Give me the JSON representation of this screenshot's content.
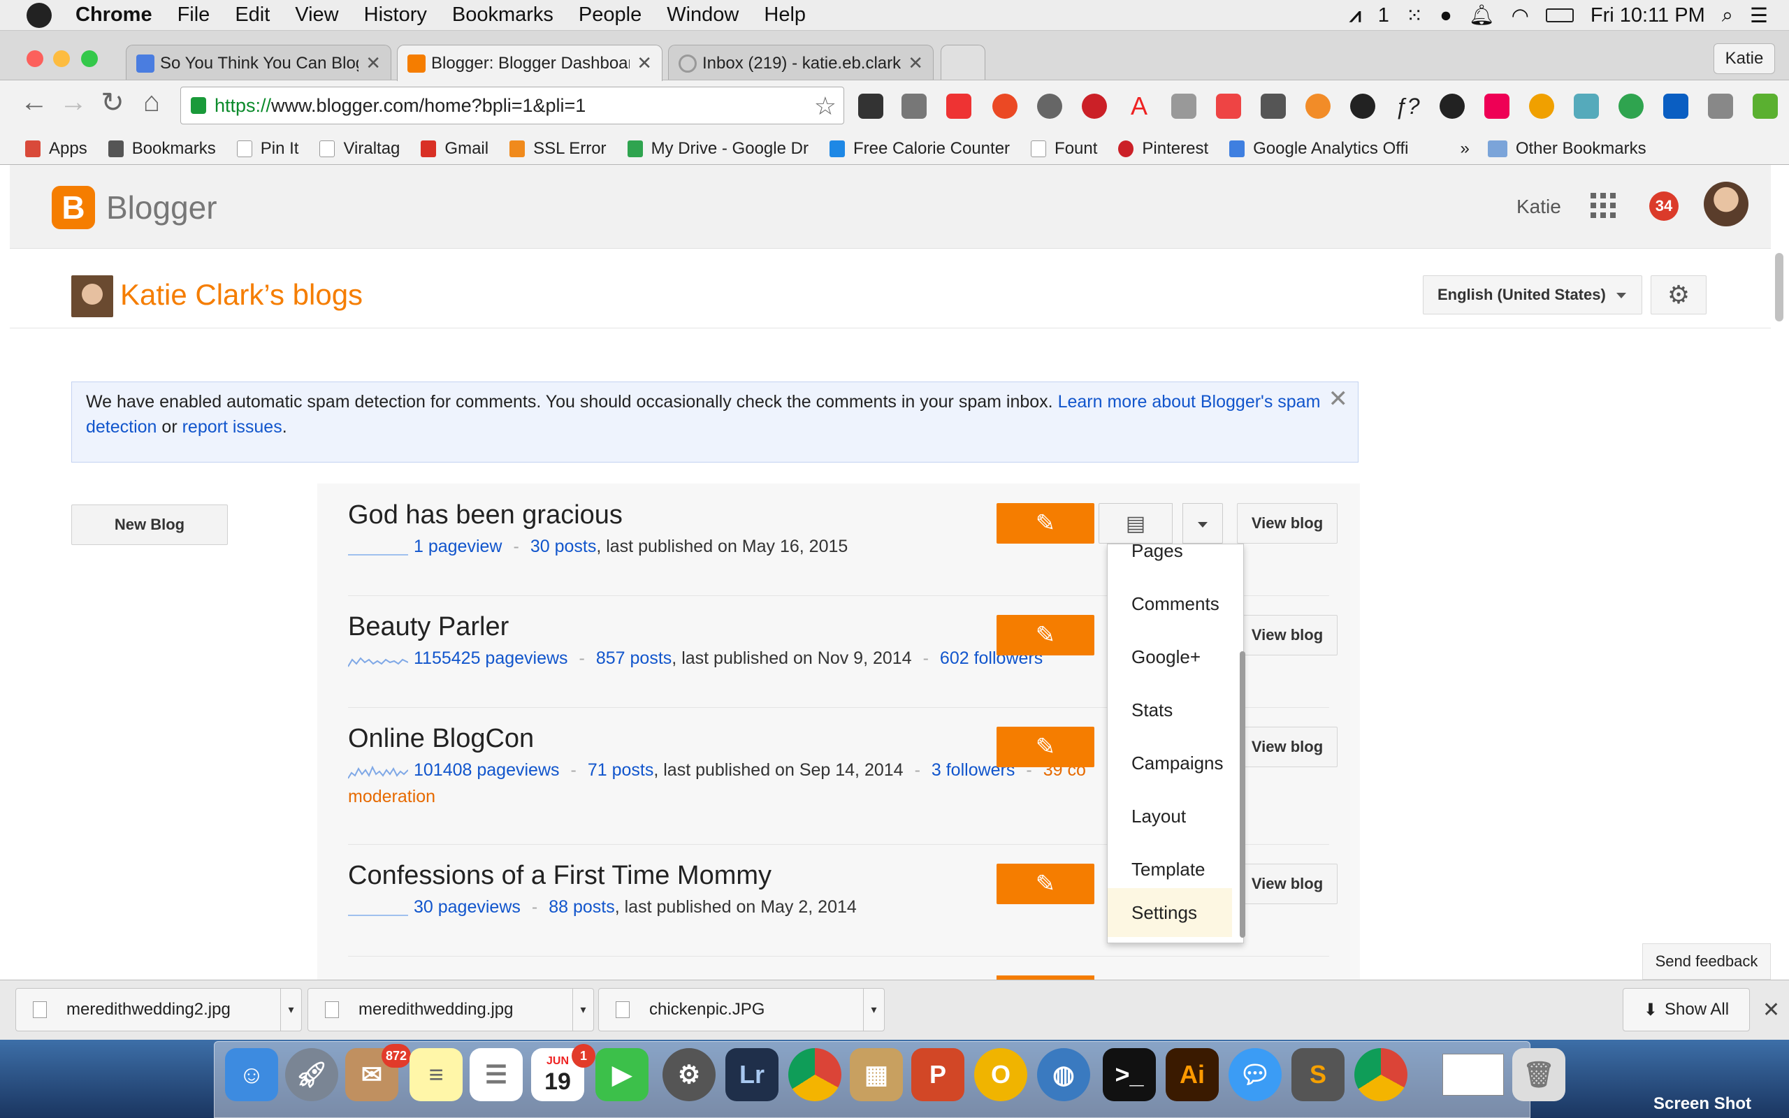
{
  "menubar": {
    "app": "Chrome",
    "items": [
      "File",
      "Edit",
      "View",
      "History",
      "Bookmarks",
      "People",
      "Window",
      "Help"
    ],
    "status_count": "1",
    "clock": "Fri 10:11 PM"
  },
  "tabs": [
    {
      "title": "So You Think You Can Blog",
      "fav_color": "#4a7de0"
    },
    {
      "title": "Blogger: Blogger Dashboard",
      "fav_color": "#f57d00"
    },
    {
      "title": "Inbox (219) - katie.eb.clark",
      "fav_color": "#999999"
    }
  ],
  "profile_name": "Katie",
  "address": {
    "scheme": "https://",
    "rest": "www.blogger.com/home?bpli=1&pli=1"
  },
  "bookmarks": [
    {
      "label": "Apps",
      "color": "#d94a3a"
    },
    {
      "label": "Bookmarks",
      "color": "#555555"
    },
    {
      "label": "Pin It",
      "color": "#dddddd"
    },
    {
      "label": "Viraltag",
      "color": "#dddddd"
    },
    {
      "label": "Gmail",
      "color": "#d93025"
    },
    {
      "label": "SSL Error",
      "color": "#f08a1c"
    },
    {
      "label": "My Drive - Google Dr",
      "color": "#2fa44f"
    },
    {
      "label": "Free Calorie Counter",
      "color": "#1e88e5"
    },
    {
      "label": "Fount",
      "color": "#dddddd"
    },
    {
      "label": "Pinterest",
      "color": "#cb2027"
    },
    {
      "label": "Google Analytics Offi",
      "color": "#3f7fe0"
    }
  ],
  "bookmarks_more": "»",
  "other_bookmarks": "Other Bookmarks",
  "blogger": {
    "brand": "Blogger",
    "user": "Katie",
    "notifications": "34",
    "page_title": "Katie Clark’s blogs",
    "language": "English (United States)",
    "notice": {
      "text": "We have enabled automatic spam detection for comments. You should occasionally check the comments in your spam inbox. ",
      "link1": "Learn more about Blogger's spam detection",
      "mid": " or ",
      "link2": "report issues",
      "end": "."
    },
    "new_blog": "New Blog",
    "view_blog": "View blog",
    "blogs": [
      {
        "name": "God has been gracious",
        "pageviews": "1 pageview",
        "posts": "30 posts",
        "published": ", last published on May 16, 2015",
        "followers": "",
        "comments": ""
      },
      {
        "name": "Beauty Parler",
        "pageviews": "1155425 pageviews",
        "posts": "857 posts",
        "published": ", last published on Nov 9, 2014",
        "followers": "602 followers",
        "comments": ""
      },
      {
        "name": "Online BlogCon",
        "pageviews": "101408 pageviews",
        "posts": "71 posts",
        "published": ", last published on Sep 14, 2014",
        "followers": "3 followers",
        "comments": "39 co",
        "comments_cont": "moderation"
      },
      {
        "name": "Confessions of a First Time Mommy",
        "pageviews": "30 pageviews",
        "posts": "88 posts",
        "published": ", last published on May 2, 2014",
        "followers": "",
        "comments": ""
      }
    ],
    "menu": [
      "Pages",
      "Comments",
      "Google+",
      "Stats",
      "Campaigns",
      "Layout",
      "Template",
      "Settings"
    ],
    "send_feedback": "Send feedback"
  },
  "downloads": [
    "meredithwedding2.jpg",
    "meredithwedding.jpg",
    "chickenpic.JPG"
  ],
  "show_all": "Show All",
  "dock": {
    "mail_badge": "872",
    "calendar_badge": "1",
    "calendar_month": "JUN",
    "calendar_day": "19",
    "screenshot_label": "Screen Shot"
  }
}
